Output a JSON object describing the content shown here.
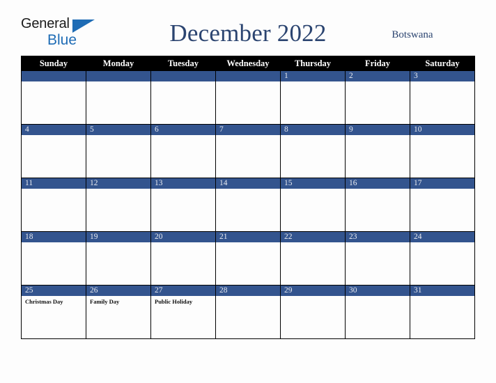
{
  "brand": {
    "name_part1": "General",
    "name_part2": "Blue",
    "triangle_icon": "triangle-icon",
    "accent_color": "#1e6cb5"
  },
  "header": {
    "title": "December 2022",
    "country": "Botswana",
    "title_color": "#2b4470"
  },
  "colors": {
    "weekday_header_bg": "#000000",
    "weekday_header_text": "#ffffff",
    "daynumber_bar_bg": "#33548e",
    "daynumber_text": "#e8eaf0",
    "cell_bg": "#fdfdfd",
    "page_bg": "#fdfdfd",
    "grid_line": "#000000"
  },
  "calendar": {
    "month": "December",
    "year": "2022",
    "weekday_headers": [
      "Sunday",
      "Monday",
      "Tuesday",
      "Wednesday",
      "Thursday",
      "Friday",
      "Saturday"
    ],
    "weeks": [
      [
        {
          "day": "",
          "events": []
        },
        {
          "day": "",
          "events": []
        },
        {
          "day": "",
          "events": []
        },
        {
          "day": "",
          "events": []
        },
        {
          "day": "1",
          "events": []
        },
        {
          "day": "2",
          "events": []
        },
        {
          "day": "3",
          "events": []
        }
      ],
      [
        {
          "day": "4",
          "events": []
        },
        {
          "day": "5",
          "events": []
        },
        {
          "day": "6",
          "events": []
        },
        {
          "day": "7",
          "events": []
        },
        {
          "day": "8",
          "events": []
        },
        {
          "day": "9",
          "events": []
        },
        {
          "day": "10",
          "events": []
        }
      ],
      [
        {
          "day": "11",
          "events": []
        },
        {
          "day": "12",
          "events": []
        },
        {
          "day": "13",
          "events": []
        },
        {
          "day": "14",
          "events": []
        },
        {
          "day": "15",
          "events": []
        },
        {
          "day": "16",
          "events": []
        },
        {
          "day": "17",
          "events": []
        }
      ],
      [
        {
          "day": "18",
          "events": []
        },
        {
          "day": "19",
          "events": []
        },
        {
          "day": "20",
          "events": []
        },
        {
          "day": "21",
          "events": []
        },
        {
          "day": "22",
          "events": []
        },
        {
          "day": "23",
          "events": []
        },
        {
          "day": "24",
          "events": []
        }
      ],
      [
        {
          "day": "25",
          "events": [
            "Christmas Day"
          ]
        },
        {
          "day": "26",
          "events": [
            "Family Day"
          ]
        },
        {
          "day": "27",
          "events": [
            "Public Holiday"
          ]
        },
        {
          "day": "28",
          "events": []
        },
        {
          "day": "29",
          "events": []
        },
        {
          "day": "30",
          "events": []
        },
        {
          "day": "31",
          "events": []
        }
      ]
    ]
  }
}
